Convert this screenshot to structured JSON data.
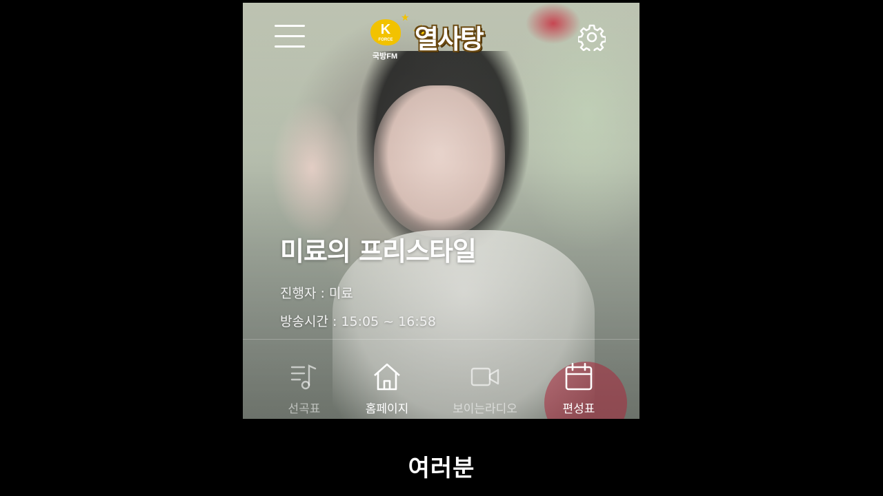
{
  "app": {
    "station_badge": "K",
    "station_badge_sub": "FORCE",
    "station_name": "국방FM",
    "show_logo": "열사탕"
  },
  "program": {
    "title": "미료의 프리스타일",
    "host": "진행자 : 미료",
    "time": "방송시간 : 15:05 ~ 16:58"
  },
  "nav": {
    "items": [
      {
        "label": "선곡표",
        "icon": "playlist-music-icon"
      },
      {
        "label": "홈페이지",
        "icon": "home-icon"
      },
      {
        "label": "보이는라디오",
        "icon": "video-camera-icon"
      },
      {
        "label": "편성표",
        "icon": "calendar-icon"
      }
    ],
    "active": "편성표"
  },
  "caption": "여러분",
  "colors": {
    "kforce_yellow": "#f2c200",
    "active_tab": "#aa283c",
    "background": "#000000"
  }
}
